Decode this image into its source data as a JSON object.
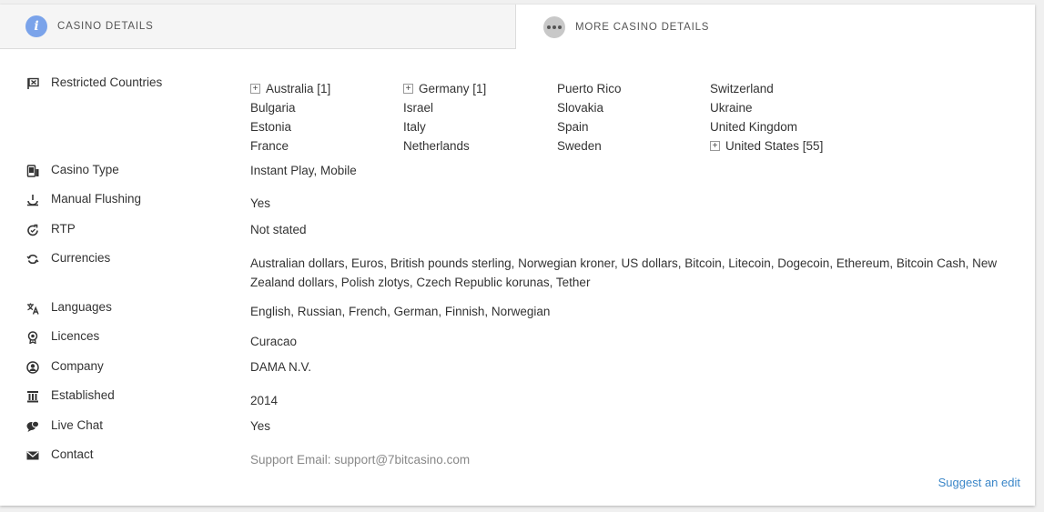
{
  "tabs": [
    {
      "label": "CASINO DETAILS",
      "icon": "info-icon",
      "icon_text": "i",
      "active": false
    },
    {
      "label": "MORE CASINO DETAILS",
      "icon": "more-icon",
      "active": true
    }
  ],
  "details": {
    "restricted_countries": {
      "label": "Restricted Countries",
      "icon": "flag-x-icon",
      "countries": [
        {
          "name": "Australia [1]",
          "expandable": true
        },
        {
          "name": "Bulgaria",
          "expandable": false
        },
        {
          "name": "Estonia",
          "expandable": false
        },
        {
          "name": "France",
          "expandable": false
        },
        {
          "name": "Germany [1]",
          "expandable": true
        },
        {
          "name": "Israel",
          "expandable": false
        },
        {
          "name": "Italy",
          "expandable": false
        },
        {
          "name": "Netherlands",
          "expandable": false
        },
        {
          "name": "Puerto Rico",
          "expandable": false
        },
        {
          "name": "Slovakia",
          "expandable": false
        },
        {
          "name": "Spain",
          "expandable": false
        },
        {
          "name": "Sweden",
          "expandable": false
        },
        {
          "name": "Switzerland",
          "expandable": false
        },
        {
          "name": "Ukraine",
          "expandable": false
        },
        {
          "name": "United Kingdom",
          "expandable": false
        },
        {
          "name": "United States [55]",
          "expandable": true
        }
      ],
      "expand_symbol": "+"
    },
    "casino_type": {
      "label": "Casino Type",
      "value": "Instant Play, Mobile",
      "icon": "device-icon"
    },
    "manual_flushing": {
      "label": "Manual Flushing",
      "value": "Yes",
      "icon": "power-icon"
    },
    "rtp": {
      "label": "RTP",
      "value": "Not stated",
      "icon": "refresh-icon"
    },
    "currencies": {
      "label": "Currencies",
      "value": "Australian dollars, Euros, British pounds sterling, Norwegian kroner, US dollars, Bitcoin, Litecoin, Dogecoin, Ethereum, Bitcoin Cash, New Zealand dollars, Polish zlotys, Czech Republic korunas, Tether",
      "icon": "currency-exchange-icon"
    },
    "languages": {
      "label": "Languages",
      "value": "English, Russian, French, German, Finnish, Norwegian",
      "icon": "translate-icon"
    },
    "licences": {
      "label": "Licences",
      "value": "Curacao",
      "icon": "award-icon"
    },
    "company": {
      "label": "Company",
      "value": "DAMA N.V.",
      "icon": "user-circle-icon"
    },
    "established": {
      "label": "Established",
      "value": "2014",
      "icon": "building-icon"
    },
    "live_chat": {
      "label": "Live Chat",
      "value": "Yes",
      "icon": "chat-icon"
    },
    "contact": {
      "label": "Contact",
      "value": "Support Email: support@7bitcasino.com",
      "icon": "envelope-icon"
    }
  },
  "suggest_edit": "Suggest an edit",
  "colors": {
    "info_icon_bg": "#7aa3ea",
    "link": "#3a86c8",
    "muted_text": "#888888"
  }
}
